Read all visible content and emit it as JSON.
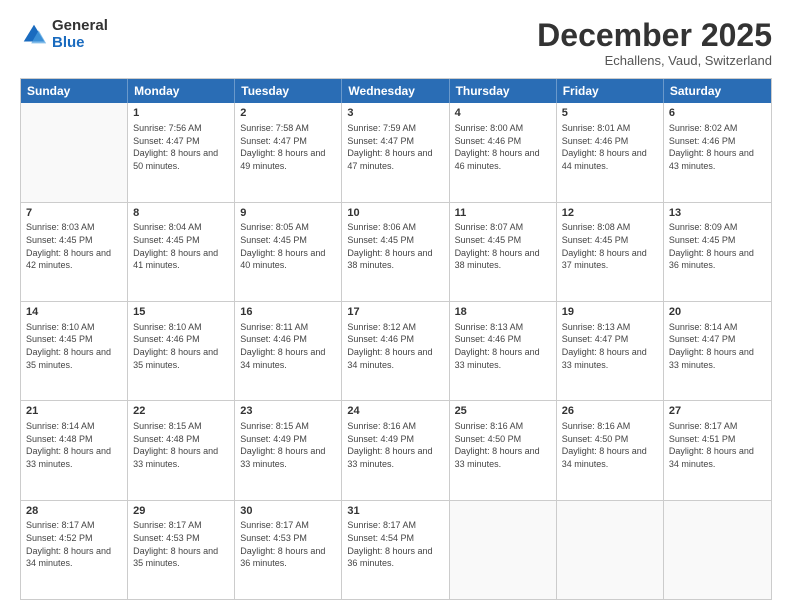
{
  "logo": {
    "general": "General",
    "blue": "Blue"
  },
  "header": {
    "month": "December 2025",
    "location": "Echallens, Vaud, Switzerland"
  },
  "weekdays": [
    "Sunday",
    "Monday",
    "Tuesday",
    "Wednesday",
    "Thursday",
    "Friday",
    "Saturday"
  ],
  "weeks": [
    [
      {
        "day": "",
        "sunrise": "",
        "sunset": "",
        "daylight": ""
      },
      {
        "day": "1",
        "sunrise": "Sunrise: 7:56 AM",
        "sunset": "Sunset: 4:47 PM",
        "daylight": "Daylight: 8 hours and 50 minutes."
      },
      {
        "day": "2",
        "sunrise": "Sunrise: 7:58 AM",
        "sunset": "Sunset: 4:47 PM",
        "daylight": "Daylight: 8 hours and 49 minutes."
      },
      {
        "day": "3",
        "sunrise": "Sunrise: 7:59 AM",
        "sunset": "Sunset: 4:47 PM",
        "daylight": "Daylight: 8 hours and 47 minutes."
      },
      {
        "day": "4",
        "sunrise": "Sunrise: 8:00 AM",
        "sunset": "Sunset: 4:46 PM",
        "daylight": "Daylight: 8 hours and 46 minutes."
      },
      {
        "day": "5",
        "sunrise": "Sunrise: 8:01 AM",
        "sunset": "Sunset: 4:46 PM",
        "daylight": "Daylight: 8 hours and 44 minutes."
      },
      {
        "day": "6",
        "sunrise": "Sunrise: 8:02 AM",
        "sunset": "Sunset: 4:46 PM",
        "daylight": "Daylight: 8 hours and 43 minutes."
      }
    ],
    [
      {
        "day": "7",
        "sunrise": "Sunrise: 8:03 AM",
        "sunset": "Sunset: 4:45 PM",
        "daylight": "Daylight: 8 hours and 42 minutes."
      },
      {
        "day": "8",
        "sunrise": "Sunrise: 8:04 AM",
        "sunset": "Sunset: 4:45 PM",
        "daylight": "Daylight: 8 hours and 41 minutes."
      },
      {
        "day": "9",
        "sunrise": "Sunrise: 8:05 AM",
        "sunset": "Sunset: 4:45 PM",
        "daylight": "Daylight: 8 hours and 40 minutes."
      },
      {
        "day": "10",
        "sunrise": "Sunrise: 8:06 AM",
        "sunset": "Sunset: 4:45 PM",
        "daylight": "Daylight: 8 hours and 38 minutes."
      },
      {
        "day": "11",
        "sunrise": "Sunrise: 8:07 AM",
        "sunset": "Sunset: 4:45 PM",
        "daylight": "Daylight: 8 hours and 38 minutes."
      },
      {
        "day": "12",
        "sunrise": "Sunrise: 8:08 AM",
        "sunset": "Sunset: 4:45 PM",
        "daylight": "Daylight: 8 hours and 37 minutes."
      },
      {
        "day": "13",
        "sunrise": "Sunrise: 8:09 AM",
        "sunset": "Sunset: 4:45 PM",
        "daylight": "Daylight: 8 hours and 36 minutes."
      }
    ],
    [
      {
        "day": "14",
        "sunrise": "Sunrise: 8:10 AM",
        "sunset": "Sunset: 4:45 PM",
        "daylight": "Daylight: 8 hours and 35 minutes."
      },
      {
        "day": "15",
        "sunrise": "Sunrise: 8:10 AM",
        "sunset": "Sunset: 4:46 PM",
        "daylight": "Daylight: 8 hours and 35 minutes."
      },
      {
        "day": "16",
        "sunrise": "Sunrise: 8:11 AM",
        "sunset": "Sunset: 4:46 PM",
        "daylight": "Daylight: 8 hours and 34 minutes."
      },
      {
        "day": "17",
        "sunrise": "Sunrise: 8:12 AM",
        "sunset": "Sunset: 4:46 PM",
        "daylight": "Daylight: 8 hours and 34 minutes."
      },
      {
        "day": "18",
        "sunrise": "Sunrise: 8:13 AM",
        "sunset": "Sunset: 4:46 PM",
        "daylight": "Daylight: 8 hours and 33 minutes."
      },
      {
        "day": "19",
        "sunrise": "Sunrise: 8:13 AM",
        "sunset": "Sunset: 4:47 PM",
        "daylight": "Daylight: 8 hours and 33 minutes."
      },
      {
        "day": "20",
        "sunrise": "Sunrise: 8:14 AM",
        "sunset": "Sunset: 4:47 PM",
        "daylight": "Daylight: 8 hours and 33 minutes."
      }
    ],
    [
      {
        "day": "21",
        "sunrise": "Sunrise: 8:14 AM",
        "sunset": "Sunset: 4:48 PM",
        "daylight": "Daylight: 8 hours and 33 minutes."
      },
      {
        "day": "22",
        "sunrise": "Sunrise: 8:15 AM",
        "sunset": "Sunset: 4:48 PM",
        "daylight": "Daylight: 8 hours and 33 minutes."
      },
      {
        "day": "23",
        "sunrise": "Sunrise: 8:15 AM",
        "sunset": "Sunset: 4:49 PM",
        "daylight": "Daylight: 8 hours and 33 minutes."
      },
      {
        "day": "24",
        "sunrise": "Sunrise: 8:16 AM",
        "sunset": "Sunset: 4:49 PM",
        "daylight": "Daylight: 8 hours and 33 minutes."
      },
      {
        "day": "25",
        "sunrise": "Sunrise: 8:16 AM",
        "sunset": "Sunset: 4:50 PM",
        "daylight": "Daylight: 8 hours and 33 minutes."
      },
      {
        "day": "26",
        "sunrise": "Sunrise: 8:16 AM",
        "sunset": "Sunset: 4:50 PM",
        "daylight": "Daylight: 8 hours and 34 minutes."
      },
      {
        "day": "27",
        "sunrise": "Sunrise: 8:17 AM",
        "sunset": "Sunset: 4:51 PM",
        "daylight": "Daylight: 8 hours and 34 minutes."
      }
    ],
    [
      {
        "day": "28",
        "sunrise": "Sunrise: 8:17 AM",
        "sunset": "Sunset: 4:52 PM",
        "daylight": "Daylight: 8 hours and 34 minutes."
      },
      {
        "day": "29",
        "sunrise": "Sunrise: 8:17 AM",
        "sunset": "Sunset: 4:53 PM",
        "daylight": "Daylight: 8 hours and 35 minutes."
      },
      {
        "day": "30",
        "sunrise": "Sunrise: 8:17 AM",
        "sunset": "Sunset: 4:53 PM",
        "daylight": "Daylight: 8 hours and 36 minutes."
      },
      {
        "day": "31",
        "sunrise": "Sunrise: 8:17 AM",
        "sunset": "Sunset: 4:54 PM",
        "daylight": "Daylight: 8 hours and 36 minutes."
      },
      {
        "day": "",
        "sunrise": "",
        "sunset": "",
        "daylight": ""
      },
      {
        "day": "",
        "sunrise": "",
        "sunset": "",
        "daylight": ""
      },
      {
        "day": "",
        "sunrise": "",
        "sunset": "",
        "daylight": ""
      }
    ]
  ]
}
